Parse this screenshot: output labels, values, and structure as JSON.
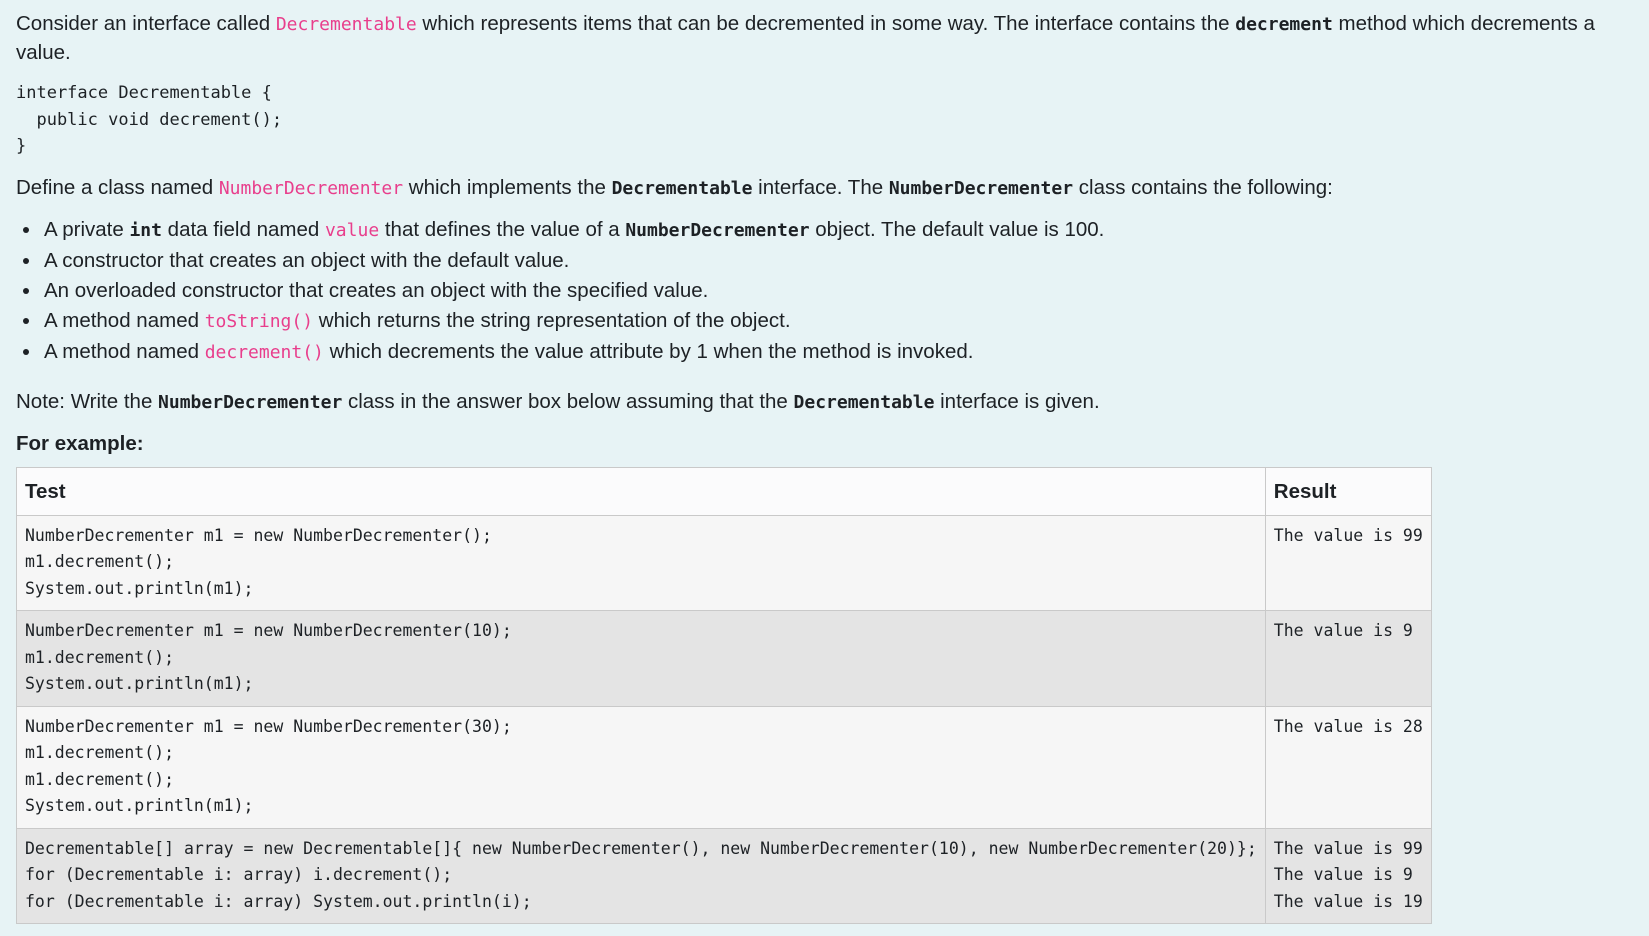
{
  "intro": {
    "part1": "Consider an interface called ",
    "iface": "Decrementable",
    "part2": " which represents items that can be decremented in some way. The interface contains the ",
    "method": "decrement",
    "part3": " method which decrements a value."
  },
  "interface_code": "interface Decrementable {\n  public void decrement();\n}",
  "define": {
    "part1": "Define a class named ",
    "cls": "NumberDecrementer",
    "part2": " which implements the ",
    "iface": "Decrementable",
    "part3": " interface. The ",
    "cls2": "NumberDecrementer",
    "part4": " class contains the following:"
  },
  "bullets": {
    "b1": {
      "a": "A private ",
      "b": "int",
      "c": " data field named ",
      "d": "value",
      "e": " that defines the value of a ",
      "f": "NumberDecrementer",
      "g": " object. The default value is 100."
    },
    "b2": "A constructor that creates an object with the default value.",
    "b3": "An overloaded constructor that creates an object with the specified value.",
    "b4": {
      "a": "A method named ",
      "b": "toString()",
      "c": " which returns the string representation of the object."
    },
    "b5": {
      "a": "A method named ",
      "b": "decrement()",
      "c": " which decrements the value attribute by 1 when the method is invoked."
    }
  },
  "note": {
    "part1": "Note: Write the ",
    "cls": "NumberDecrementer",
    "part2": " class in the answer box below assuming that the ",
    "iface": "Decrementable",
    "part3": " interface is given."
  },
  "for_example": "For example:",
  "table": {
    "headers": [
      "Test",
      "Result"
    ],
    "rows": [
      {
        "test": "NumberDecrementer m1 = new NumberDecrementer();\nm1.decrement();\nSystem.out.println(m1);",
        "result": "The value is 99"
      },
      {
        "test": "NumberDecrementer m1 = new NumberDecrementer(10);\nm1.decrement();\nSystem.out.println(m1);",
        "result": "The value is 9"
      },
      {
        "test": "NumberDecrementer m1 = new NumberDecrementer(30);\nm1.decrement();\nm1.decrement();\nSystem.out.println(m1);",
        "result": "The value is 28"
      },
      {
        "test": "Decrementable[] array = new Decrementable[]{ new NumberDecrementer(), new NumberDecrementer(10), new NumberDecrementer(20)};\nfor (Decrementable i: array) i.decrement();\nfor (Decrementable i: array) System.out.println(i);",
        "result": "The value is 99\nThe value is 9\nThe value is 19"
      }
    ]
  }
}
